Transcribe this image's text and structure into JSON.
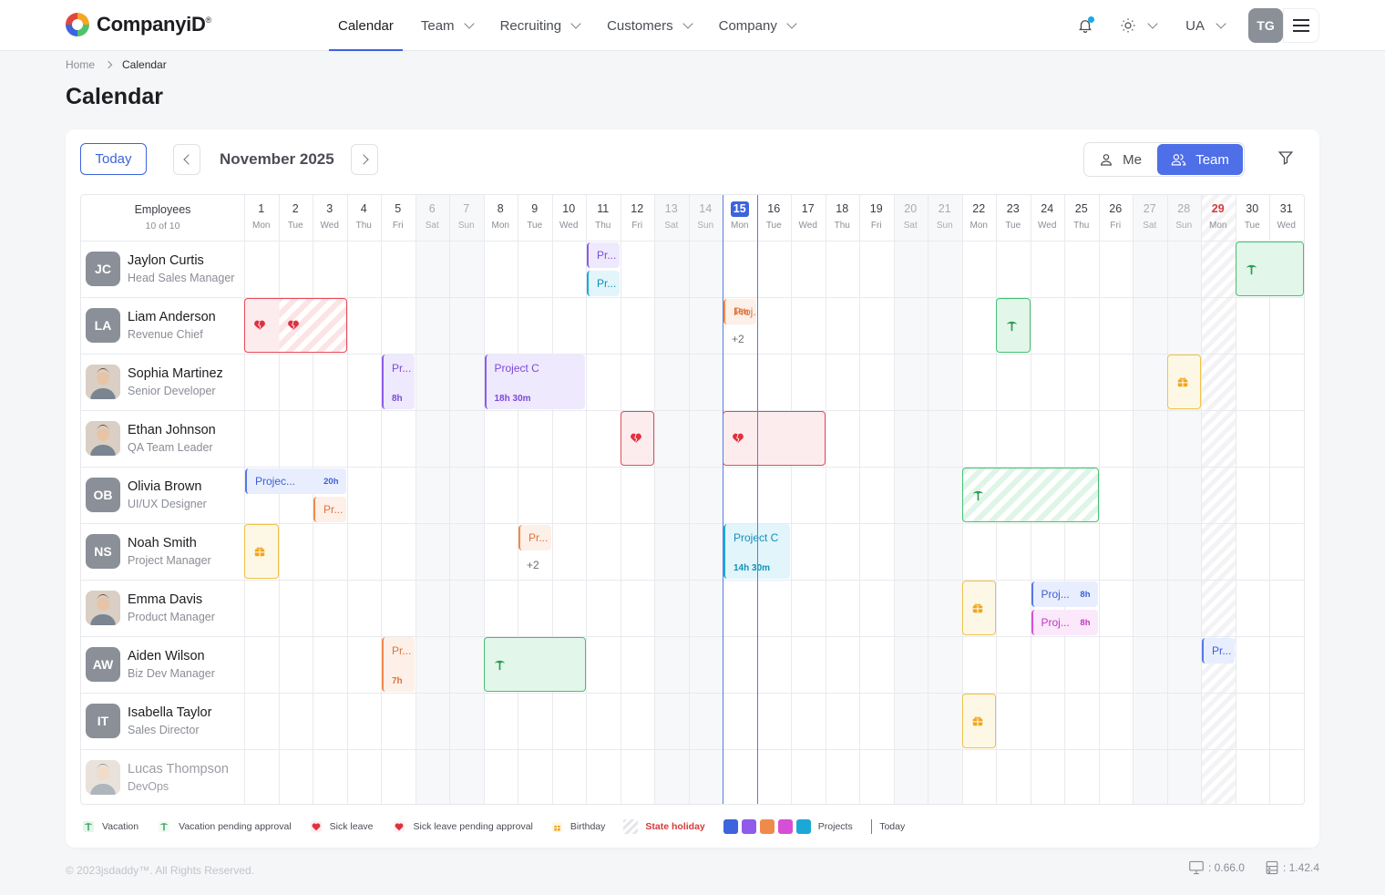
{
  "header": {
    "brand": "CompanyiD",
    "trademark": "®",
    "nav": [
      {
        "label": "Calendar",
        "active": true,
        "dropdown": false
      },
      {
        "label": "Team",
        "dropdown": true
      },
      {
        "label": "Recruiting",
        "dropdown": true
      },
      {
        "label": "Customers",
        "dropdown": true
      },
      {
        "label": "Company",
        "dropdown": true
      }
    ],
    "language": "UA",
    "user_initials": "TG",
    "accent": "#3d63dd"
  },
  "breadcrumb": {
    "home": "Home",
    "current": "Calendar"
  },
  "page_title": "Calendar",
  "toolbar": {
    "today_label": "Today",
    "month_label": "November 2025",
    "view_me": "Me",
    "view_team": "Team",
    "active_view": "Team"
  },
  "grid": {
    "employees_header": "Employees",
    "employees_count": "10 of 10",
    "today_day": 15,
    "holiday_day": 29,
    "days": [
      {
        "n": "1",
        "w": "Mon"
      },
      {
        "n": "2",
        "w": "Tue"
      },
      {
        "n": "3",
        "w": "Wed"
      },
      {
        "n": "4",
        "w": "Thu"
      },
      {
        "n": "5",
        "w": "Fri"
      },
      {
        "n": "6",
        "w": "Sat"
      },
      {
        "n": "7",
        "w": "Sun"
      },
      {
        "n": "8",
        "w": "Mon"
      },
      {
        "n": "9",
        "w": "Tue"
      },
      {
        "n": "10",
        "w": "Wed"
      },
      {
        "n": "11",
        "w": "Thu"
      },
      {
        "n": "12",
        "w": "Fri"
      },
      {
        "n": "13",
        "w": "Sat"
      },
      {
        "n": "14",
        "w": "Sun"
      },
      {
        "n": "15",
        "w": "Mon"
      },
      {
        "n": "16",
        "w": "Tue"
      },
      {
        "n": "17",
        "w": "Wed"
      },
      {
        "n": "18",
        "w": "Thu"
      },
      {
        "n": "19",
        "w": "Fri"
      },
      {
        "n": "20",
        "w": "Sat"
      },
      {
        "n": "21",
        "w": "Sun"
      },
      {
        "n": "22",
        "w": "Mon"
      },
      {
        "n": "23",
        "w": "Tue"
      },
      {
        "n": "24",
        "w": "Wed"
      },
      {
        "n": "25",
        "w": "Thu"
      },
      {
        "n": "26",
        "w": "Fri"
      },
      {
        "n": "27",
        "w": "Sat"
      },
      {
        "n": "28",
        "w": "Sun"
      },
      {
        "n": "29",
        "w": "Mon"
      },
      {
        "n": "30",
        "w": "Tue"
      },
      {
        "n": "31",
        "w": "Wed"
      }
    ],
    "employees": [
      {
        "initials": "JC",
        "name": "Jaylon Curtis",
        "role": "Head Sales Manager",
        "photo": false
      },
      {
        "initials": "LA",
        "name": "Liam Anderson",
        "role": "Revenue Chief",
        "photo": false
      },
      {
        "initials": "",
        "name": "Sophia Martinez",
        "role": "Senior Developer",
        "photo": true
      },
      {
        "initials": "",
        "name": "Ethan Johnson",
        "role": "QA Team Leader",
        "photo": true
      },
      {
        "initials": "OB",
        "name": "Olivia Brown",
        "role": "UI/UX Designer",
        "photo": false
      },
      {
        "initials": "NS",
        "name": "Noah Smith",
        "role": "Project Manager",
        "photo": false
      },
      {
        "initials": "",
        "name": "Emma Davis",
        "role": "Product Manager",
        "photo": true
      },
      {
        "initials": "AW",
        "name": "Aiden Wilson",
        "role": "Biz Dev Manager",
        "photo": false
      },
      {
        "initials": "IT",
        "name": "Isabella Taylor",
        "role": "Sales Director",
        "photo": false
      },
      {
        "initials": "",
        "name": "Lucas Thompson",
        "role": "DevOps",
        "photo": true,
        "dim": true
      }
    ],
    "events": [
      {
        "row": 0,
        "start": 11,
        "end": 11,
        "type": "project",
        "color": "purple",
        "label": "Pr...",
        "slot": "top"
      },
      {
        "row": 0,
        "start": 11,
        "end": 11,
        "type": "project",
        "color": "cyan",
        "label": "Pr...",
        "slot": "bottom"
      },
      {
        "row": 0,
        "start": 30,
        "end": 31,
        "type": "vacation"
      },
      {
        "row": 1,
        "start": 1,
        "end": 3,
        "type": "sick"
      },
      {
        "row": 1,
        "start": 15,
        "end": 15,
        "type": "project",
        "color": "orange",
        "label": "Proj...",
        "hours": "16h",
        "slot": "top"
      },
      {
        "row": 1,
        "start": 23,
        "end": 23,
        "type": "vacation"
      },
      {
        "row": 2,
        "start": 5,
        "end": 5,
        "type": "project",
        "color": "purple",
        "label": "Pr...",
        "duration": "8h",
        "slot": "full"
      },
      {
        "row": 2,
        "start": 8,
        "end": 10,
        "type": "project",
        "color": "purple",
        "label": "Project C",
        "duration": "18h 30m",
        "slot": "full"
      },
      {
        "row": 2,
        "start": 28,
        "end": 28,
        "type": "birthday"
      },
      {
        "row": 3,
        "start": 12,
        "end": 12,
        "type": "sick"
      },
      {
        "row": 3,
        "start": 15,
        "end": 17,
        "type": "sick"
      },
      {
        "row": 4,
        "start": 1,
        "end": 3,
        "type": "project",
        "color": "blue",
        "label": "Projec...",
        "hours": "20h",
        "slot": "top"
      },
      {
        "row": 4,
        "start": 3,
        "end": 3,
        "type": "project",
        "color": "orange",
        "label": "Pr...",
        "slot": "bottom"
      },
      {
        "row": 4,
        "start": 22,
        "end": 25,
        "type": "vacation-pending"
      },
      {
        "row": 5,
        "start": 1,
        "end": 1,
        "type": "birthday"
      },
      {
        "row": 5,
        "start": 9,
        "end": 9,
        "type": "project",
        "color": "orange",
        "label": "Pr...",
        "slot": "top"
      },
      {
        "row": 5,
        "start": 15,
        "end": 16,
        "type": "project",
        "color": "cyan",
        "label": "Project C",
        "duration": "14h 30m",
        "slot": "full"
      },
      {
        "row": 6,
        "start": 22,
        "end": 22,
        "type": "birthday"
      },
      {
        "row": 6,
        "start": 24,
        "end": 25,
        "type": "project",
        "color": "blue",
        "label": "Proj...",
        "hours": "8h",
        "slot": "top"
      },
      {
        "row": 6,
        "start": 24,
        "end": 25,
        "type": "project",
        "color": "pink",
        "label": "Proj...",
        "hours": "8h",
        "slot": "bottom"
      },
      {
        "row": 7,
        "start": 5,
        "end": 5,
        "type": "project",
        "color": "orange",
        "label": "Pr...",
        "duration": "7h",
        "slot": "full"
      },
      {
        "row": 7,
        "start": 8,
        "end": 10,
        "type": "vacation"
      },
      {
        "row": 7,
        "start": 29,
        "end": 29,
        "type": "project",
        "color": "blue",
        "label": "Pr...",
        "slot": "top"
      },
      {
        "row": 8,
        "start": 22,
        "end": 22,
        "type": "birthday"
      }
    ],
    "more": [
      {
        "row": 1,
        "day": 15,
        "label": "+2"
      },
      {
        "row": 5,
        "day": 9,
        "label": "+2"
      }
    ]
  },
  "legend": {
    "vacation": "Vacation",
    "vacation_pending": "Vacation pending approval",
    "sick": "Sick leave",
    "sick_pending": "Sick leave pending approval",
    "birthday": "Birthday",
    "holiday": "State holiday",
    "projects": "Projects",
    "project_colors": [
      "#3d63dd",
      "#8f5be8",
      "#f08a4b",
      "#d64fd6",
      "#1aa9d6"
    ],
    "today": "Today"
  },
  "footer": {
    "copyright": "© 2023jsdaddy™. All Rights Reserved.",
    "frontend_version": ": 0.66.0",
    "backend_version": ": 1.42.4"
  }
}
